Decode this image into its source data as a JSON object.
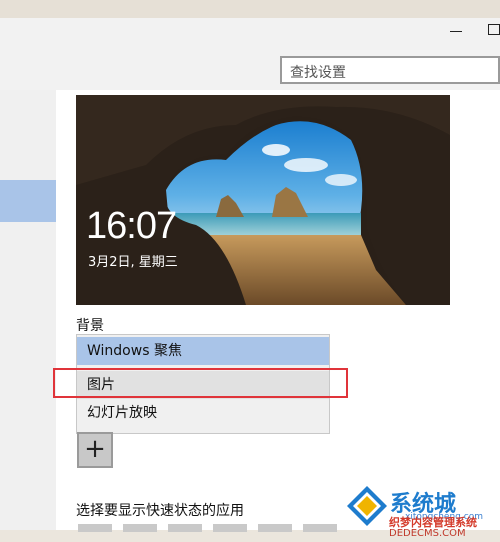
{
  "window": {
    "search_placeholder": "查找设置"
  },
  "lockscreen_preview": {
    "time": "16:07",
    "date": "3月2日, 星期三"
  },
  "background": {
    "label": "背景",
    "options": [
      "Windows 聚焦",
      "图片",
      "幻灯片放映"
    ],
    "selected": "Windows 聚焦",
    "highlighted_by_annotation": "图片",
    "add_button": "+"
  },
  "quick_status": {
    "label": "选择要显示快速状态的应用"
  },
  "watermark": {
    "site_name": "系统城",
    "site_url_small": "xitongcheng.com",
    "brand_red": "织梦内容管理系统",
    "url": "DEDECMS.COM"
  },
  "colors": {
    "selection": "#a9c4e8",
    "annotation": "#e0343a",
    "hover": "#e1e1e1"
  }
}
